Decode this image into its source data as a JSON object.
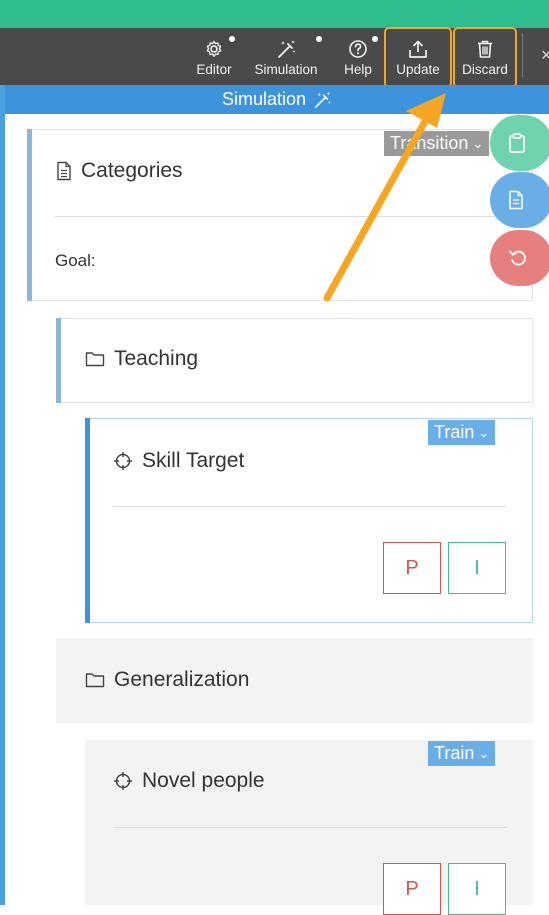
{
  "toolbar": {
    "editor_label": "Editor",
    "simulation_label": "Simulation",
    "help_label": "Help",
    "update_label": "Update",
    "discard_label": "Discard",
    "close_glyph": "×"
  },
  "panel": {
    "title": "Simulation"
  },
  "categories": {
    "title": "Categories",
    "badge": "Transition",
    "goal_label": "Goal:"
  },
  "teaching": {
    "title": "Teaching"
  },
  "skill_target": {
    "title": "Skill Target",
    "badge": "Train",
    "p_label": "P",
    "i_label": "I"
  },
  "generalization": {
    "title": "Generalization"
  },
  "novel_people": {
    "title": "Novel people",
    "badge": "Train",
    "p_label": "P",
    "i_label": "I"
  },
  "colors": {
    "accent_blue": "#3d94dd",
    "highlight_orange": "#f5a623",
    "teal": "#2dbd8f",
    "fab_green": "#6fd4ad",
    "fab_blue": "#6aaee8",
    "fab_red": "#e77f7f",
    "p_red": "#d9534f",
    "i_green": "#3fbf8f"
  }
}
